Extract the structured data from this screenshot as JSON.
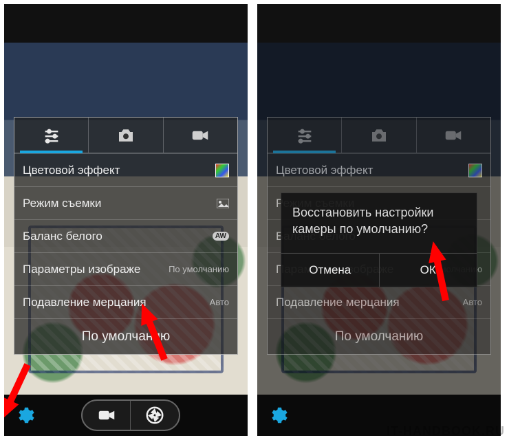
{
  "accent": "#1aa7e0",
  "settings": {
    "rows": [
      {
        "label": "Цветовой эффект",
        "value": ""
      },
      {
        "label": "Режим съемки",
        "value": ""
      },
      {
        "label": "Баланс белого",
        "value": ""
      },
      {
        "label": "Параметры изображе",
        "value": "По умолчанию"
      },
      {
        "label": "Подавление мерцания",
        "value": "Авто"
      }
    ],
    "footer": "По умолчанию"
  },
  "dialog": {
    "message": "Восстановить настройки камеры по умолчанию?",
    "cancel": "Отмена",
    "ok": "ОК"
  },
  "watermark": "IT-HANDBOOK.RU"
}
